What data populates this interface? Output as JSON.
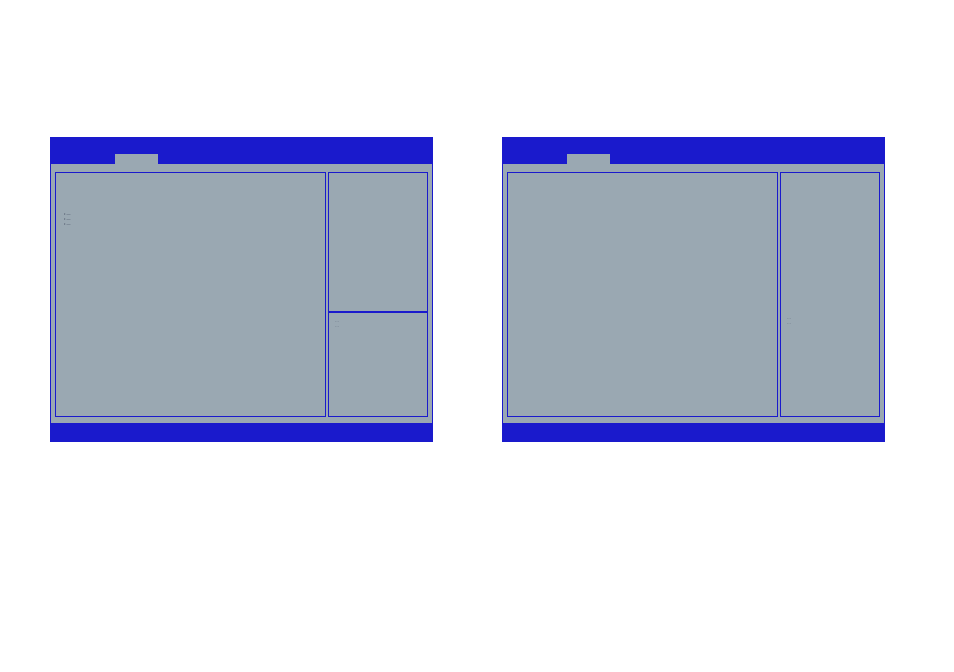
{
  "colors": {
    "panel_bg": "#9aa8b2",
    "accent": "#1a1acc"
  },
  "mockups": [
    {
      "id": "layout-a",
      "menu_text": "• —\n• —\n• —",
      "developer_text": "…\n…"
    },
    {
      "id": "layout-b",
      "developer_text": "…\n…"
    }
  ]
}
